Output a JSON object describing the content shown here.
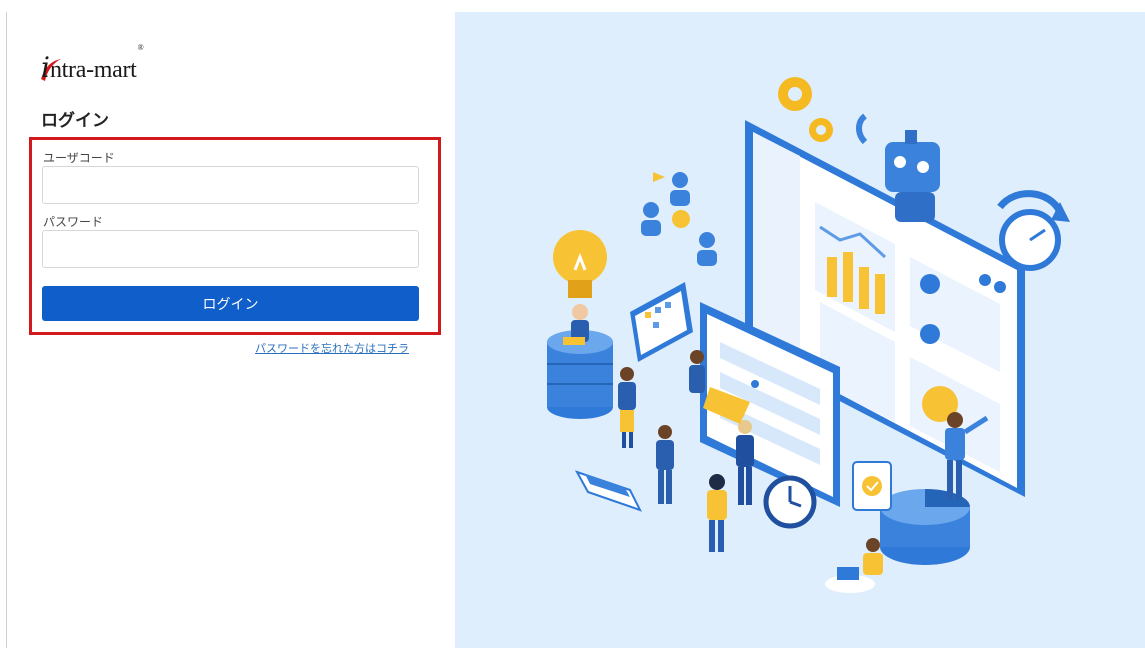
{
  "brand": {
    "logo_initial": "i",
    "logo_rest": "ntra-mart",
    "logo_registered": "®"
  },
  "login_form": {
    "title": "ログイン",
    "usercode_label": "ユーザコード",
    "usercode_value": "",
    "password_label": "パスワード",
    "password_value": "",
    "submit_label": "ログイン",
    "forgot_password_link": "パスワードを忘れた方はコチラ"
  },
  "colors": {
    "primary_button": "#0f5ec9",
    "highlight_border": "#d4191c",
    "illustration_background": "#dfeefc",
    "link": "#2a6fbf"
  }
}
